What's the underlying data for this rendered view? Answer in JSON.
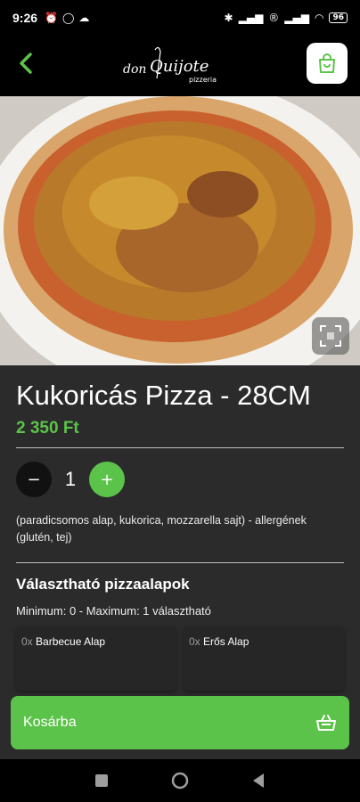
{
  "status_bar": {
    "time": "9:26",
    "battery": "96"
  },
  "header": {
    "logo_text_1": "don",
    "logo_text_2": "Quijote",
    "logo_subtext": "pizzeria"
  },
  "product": {
    "title": "Kukoricás Pizza - 28CM",
    "price": "2 350 Ft",
    "quantity": "1",
    "description": "(paradicsomos alap, kukorica, mozzarella sajt) - allergének (glutén, tej)"
  },
  "quantity_controls": {
    "minus": "−",
    "plus": "+"
  },
  "options_section": {
    "title": "Választható pizzaalapok",
    "subtitle": "Minimum: 0 - Maximum: 1 választható",
    "items": [
      {
        "qty": "0x",
        "label": "Barbecue Alap"
      },
      {
        "qty": "0x",
        "label": "Erős Alap"
      }
    ]
  },
  "cart_button": {
    "label": "Kosárba"
  },
  "colors": {
    "accent": "#5cc34a",
    "background": "#2b2b2b",
    "header": "#000000"
  }
}
